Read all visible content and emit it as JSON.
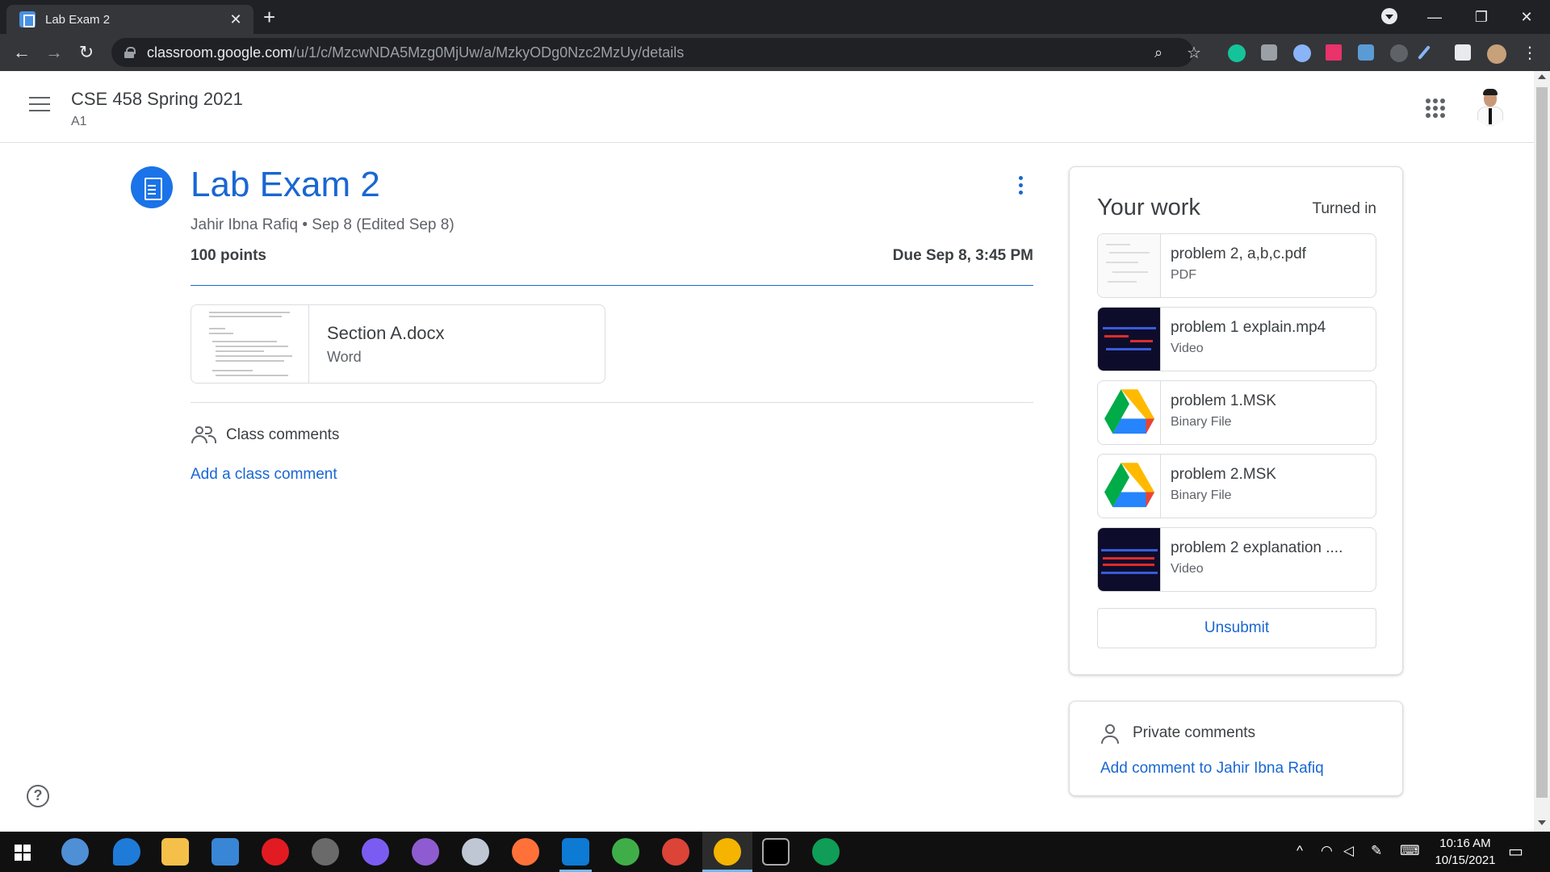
{
  "browser": {
    "tab_title": "Lab Exam 2",
    "url_host": "classroom.google.com",
    "url_path": "/u/1/c/MzcwNDA5Mzg0MjUw/a/MzkyODg0Nzc2MzUy/details"
  },
  "header": {
    "course": "CSE 458 Spring 2021",
    "section": "A1"
  },
  "assignment": {
    "title": "Lab Exam 2",
    "meta": "Jahir Ibna Rafiq • Sep 8 (Edited Sep 8)",
    "points": "100 points",
    "due": "Due Sep 8, 3:45 PM",
    "attachment": {
      "name": "Section A.docx",
      "type": "Word"
    }
  },
  "class_comments": {
    "label": "Class comments",
    "add": "Add a class comment"
  },
  "your_work": {
    "title": "Your work",
    "status": "Turned in",
    "files": [
      {
        "name": "problem 2, a,b,c.pdf",
        "type": "PDF",
        "icon": "pdf-thumbnail"
      },
      {
        "name": "problem 1 explain.mp4",
        "type": "Video",
        "icon": "video-thumbnail"
      },
      {
        "name": "problem 1.MSK",
        "type": "Binary File",
        "icon": "google-drive-icon"
      },
      {
        "name": "problem 2.MSK",
        "type": "Binary File",
        "icon": "google-drive-icon"
      },
      {
        "name": "problem 2 explanation ....",
        "type": "Video",
        "icon": "video-thumbnail"
      }
    ],
    "unsubmit": "Unsubmit"
  },
  "private_comments": {
    "label": "Private comments",
    "add": "Add comment to Jahir Ibna Rafiq"
  },
  "taskbar": {
    "time": "10:16 AM",
    "date": "10/15/2021"
  },
  "colors": {
    "primary_blue": "#1967d2",
    "icon_blue": "#1a73e8",
    "text_dark": "#3c4043",
    "text_grey": "#5f6368"
  }
}
